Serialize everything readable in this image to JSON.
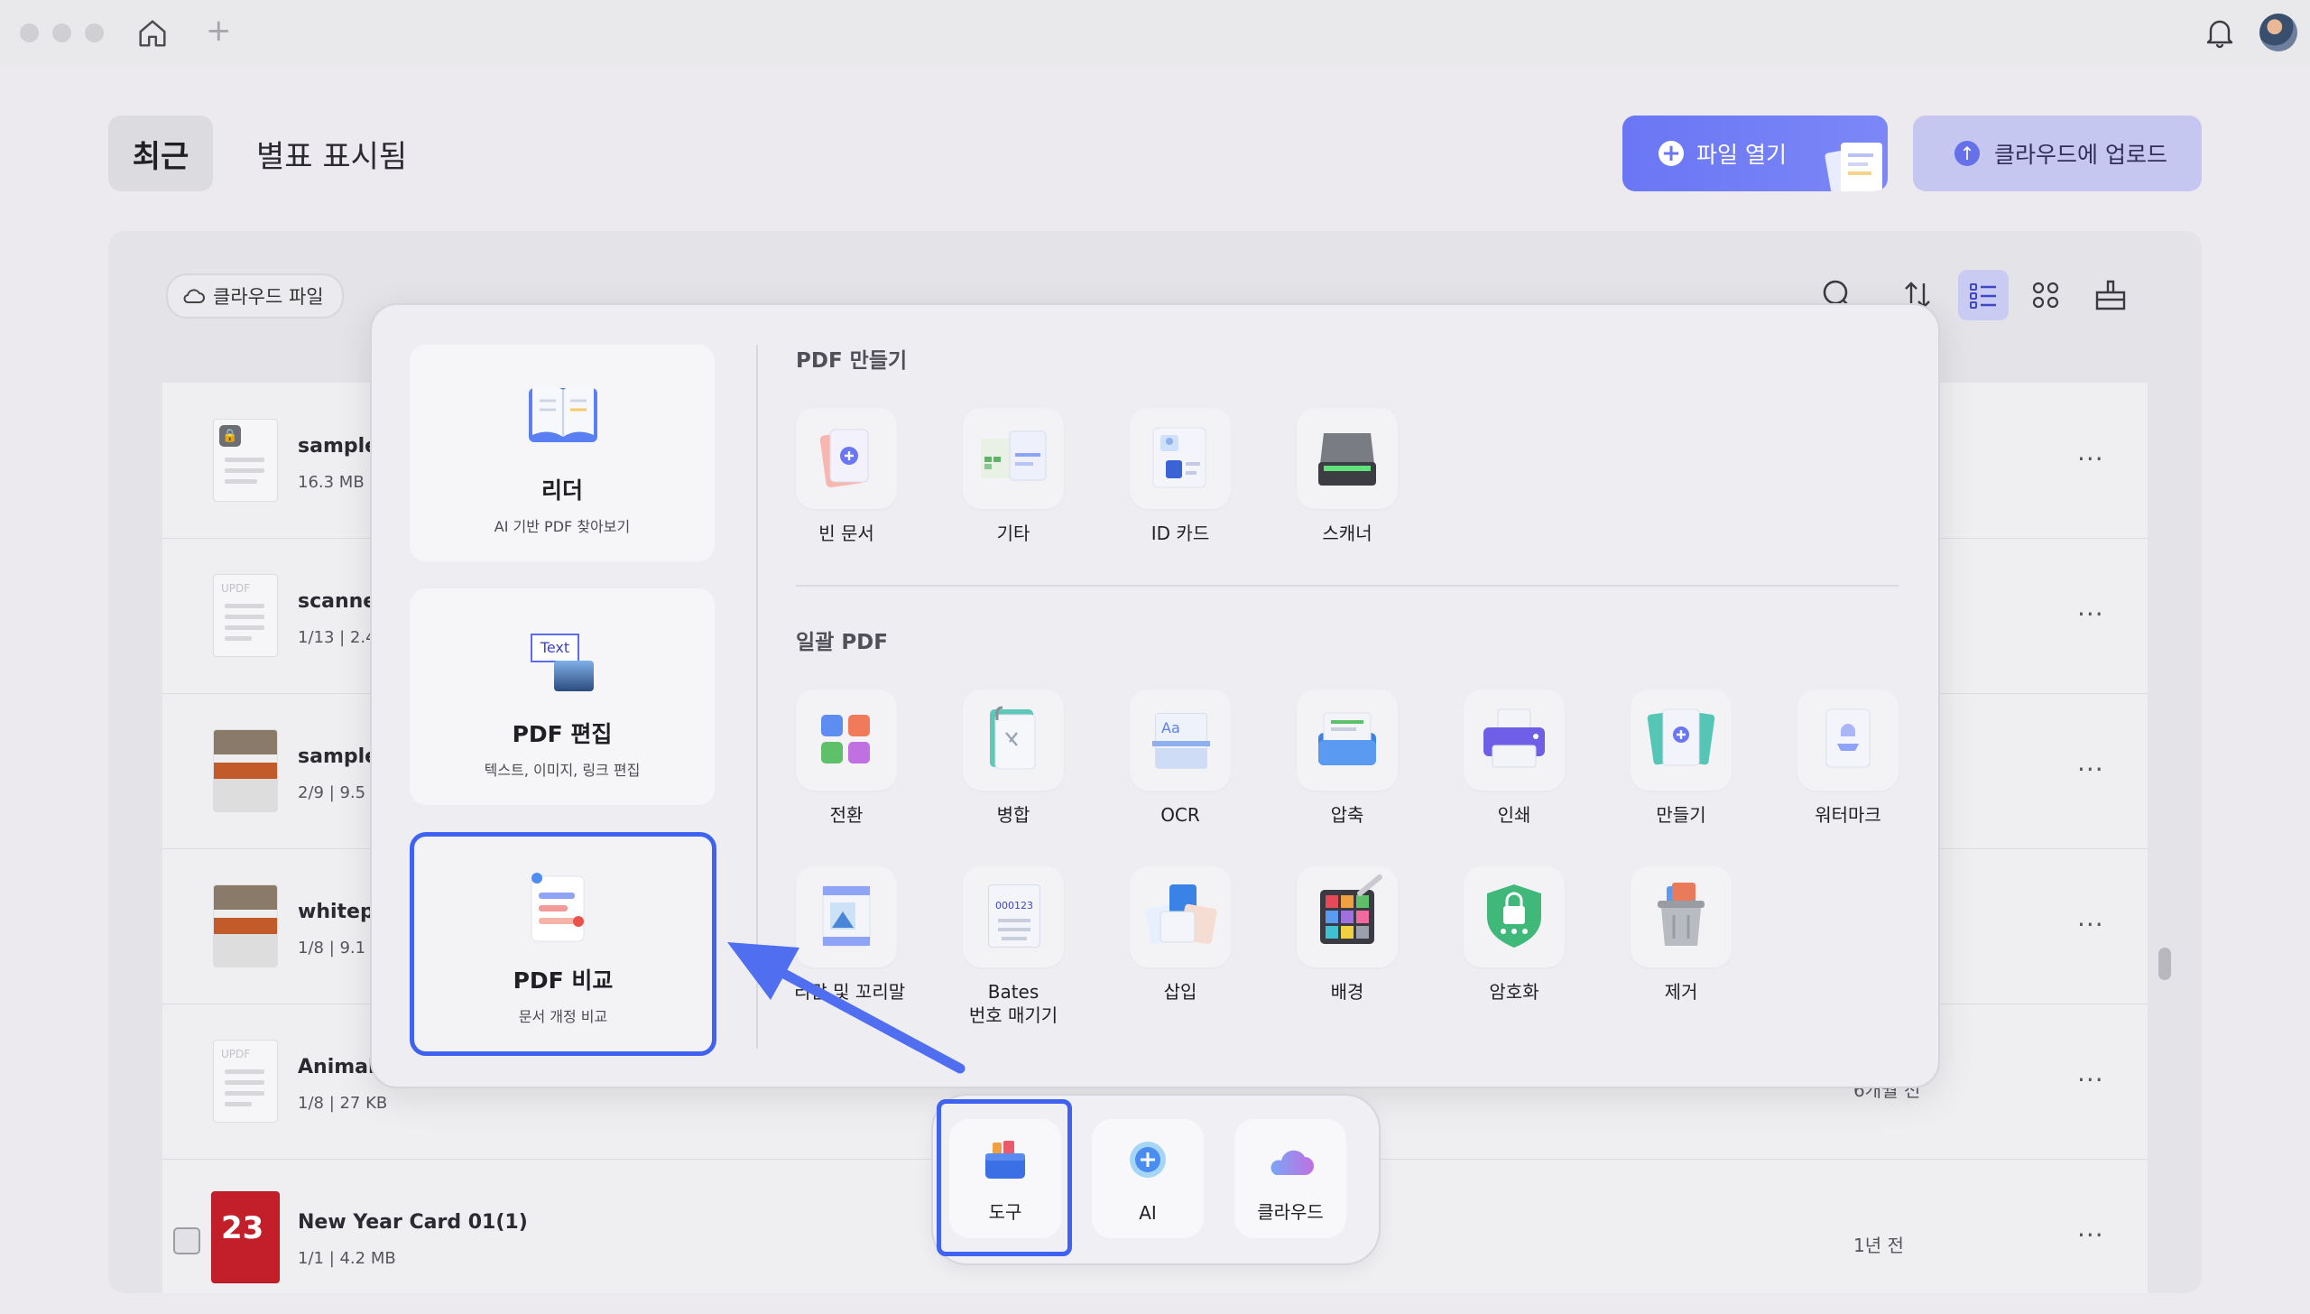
{
  "header": {
    "tabs": [
      {
        "label": "최근",
        "active": true
      },
      {
        "label": "별표 표시됨",
        "active": false
      }
    ],
    "open_file_label": "파일 열기",
    "upload_cloud_label": "클라우드에 업로드"
  },
  "list": {
    "cloud_filter_label": "클라우드 파일",
    "files": [
      {
        "name": "sample-",
        "meta": "16.3 MB",
        "date": "",
        "locked": true
      },
      {
        "name": "scanned",
        "meta": "1/13 | 2.4",
        "date": ""
      },
      {
        "name": "samplel",
        "meta": "2/9 | 9.5",
        "date": ""
      },
      {
        "name": "whitepa",
        "meta": "1/8 | 9.1",
        "date": ""
      },
      {
        "name": "Animal Pa",
        "meta": "1/8 | 27 KB",
        "date": "6개월 전"
      },
      {
        "name": "New Year Card 01(1)",
        "meta": "1/1 | 4.2 MB",
        "date": "1년 전"
      }
    ],
    "more_label": "···",
    "thumb_text": "UPDF",
    "card_number": "23"
  },
  "popup": {
    "cards": [
      {
        "title": "리더",
        "subtitle": "AI 기반 PDF 찾아보기"
      },
      {
        "title": "PDF 편집",
        "subtitle": "텍스트, 이미지, 링크 편집",
        "icon_text": "Text"
      },
      {
        "title": "PDF 비교",
        "subtitle": "문서 개정 비교",
        "selected": true
      }
    ],
    "create_section": {
      "title": "PDF 만들기",
      "tools": [
        {
          "label": "빈 문서",
          "icon": "blank-doc-icon"
        },
        {
          "label": "기타",
          "icon": "other-icon"
        },
        {
          "label": "ID 카드",
          "icon": "id-card-icon"
        },
        {
          "label": "스캐너",
          "icon": "scanner-icon"
        }
      ]
    },
    "batch_section": {
      "title": "일괄 PDF",
      "tools": [
        {
          "label": "전환",
          "icon": "convert-icon"
        },
        {
          "label": "병합",
          "icon": "merge-icon"
        },
        {
          "label": "OCR",
          "icon": "ocr-icon",
          "icon_text": "Aa"
        },
        {
          "label": "압축",
          "icon": "compress-icon"
        },
        {
          "label": "인쇄",
          "icon": "print-icon"
        },
        {
          "label": "만들기",
          "icon": "create-icon"
        },
        {
          "label": "워터마크",
          "icon": "watermark-icon"
        },
        {
          "label": "리말 및 꼬리말",
          "icon": "header-footer-icon"
        },
        {
          "label": "Bates\n번호 매기기",
          "label_line1": "Bates",
          "label_line2": "번호 매기기",
          "icon": "bates-icon",
          "icon_text": "000123"
        },
        {
          "label": "삽입",
          "icon": "insert-icon"
        },
        {
          "label": "배경",
          "icon": "background-icon"
        },
        {
          "label": "암호화",
          "icon": "encrypt-icon"
        },
        {
          "label": "제거",
          "icon": "remove-icon"
        }
      ]
    }
  },
  "dock": {
    "items": [
      {
        "label": "도구",
        "selected": true
      },
      {
        "label": "AI"
      },
      {
        "label": "클라우드"
      }
    ]
  },
  "colors": {
    "accent": "#3f63f0",
    "primary_button": "#6a76f4",
    "secondary_button": "#c5c7f0"
  }
}
